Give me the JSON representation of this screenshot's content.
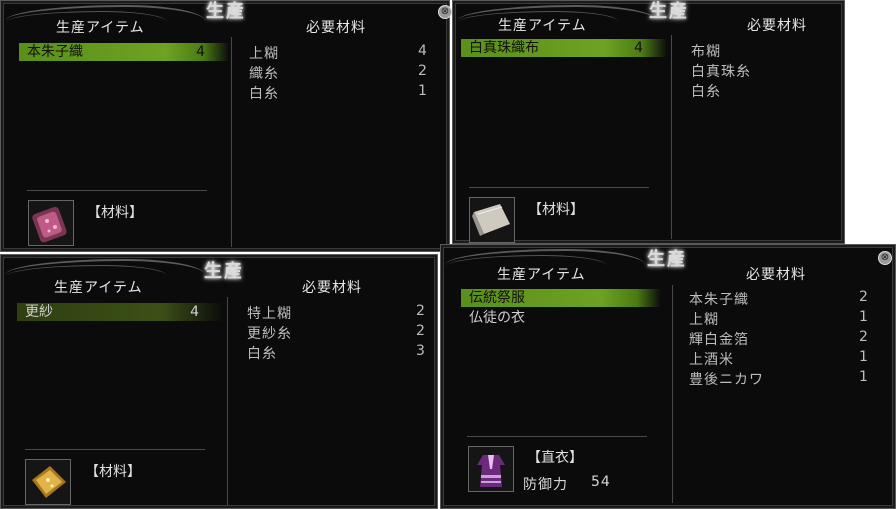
{
  "panels": [
    {
      "title": "生産",
      "header_items": "生産アイテム",
      "header_materials": "必要材料",
      "items": [
        {
          "name": "本朱子織",
          "count": "4"
        }
      ],
      "materials": [
        {
          "name": "上糊",
          "qty": "4"
        },
        {
          "name": "織糸",
          "qty": "2"
        },
        {
          "name": "白糸",
          "qty": "1"
        }
      ],
      "category": "【材料】",
      "icon": "pink-fabric-icon"
    },
    {
      "title": "生産",
      "header_items": "生産アイテム",
      "header_materials": "必要材料",
      "items": [
        {
          "name": "白真珠織布",
          "count": "4"
        }
      ],
      "materials": [
        {
          "name": "布糊"
        },
        {
          "name": "白真珠糸"
        },
        {
          "name": "白糸"
        }
      ],
      "category": "【材料】",
      "icon": "white-cloth-roll-icon"
    },
    {
      "title": "生産",
      "header_items": "生産アイテム",
      "header_materials": "必要材料",
      "items": [
        {
          "name": "更紗",
          "count": "4"
        }
      ],
      "materials": [
        {
          "name": "特上糊",
          "qty": "2"
        },
        {
          "name": "更紗糸",
          "qty": "2"
        },
        {
          "name": "白糸",
          "qty": "3"
        }
      ],
      "category": "【材料】",
      "icon": "gold-fabric-icon"
    },
    {
      "title": "生産",
      "header_items": "生産アイテム",
      "header_materials": "必要材料",
      "items": [
        {
          "name": "伝統祭服"
        },
        {
          "name": "仏徒の衣"
        }
      ],
      "materials": [
        {
          "name": "本朱子織",
          "qty": "2"
        },
        {
          "name": "上糊",
          "qty": "1"
        },
        {
          "name": "輝白金箔",
          "qty": "2"
        },
        {
          "name": "上酒米",
          "qty": "1"
        },
        {
          "name": "豊後ニカワ",
          "qty": "1"
        }
      ],
      "category": "【直衣】",
      "stat_label": "防御力",
      "stat_value": "54",
      "icon": "purple-robe-icon"
    }
  ],
  "close_glyph": "⊗"
}
